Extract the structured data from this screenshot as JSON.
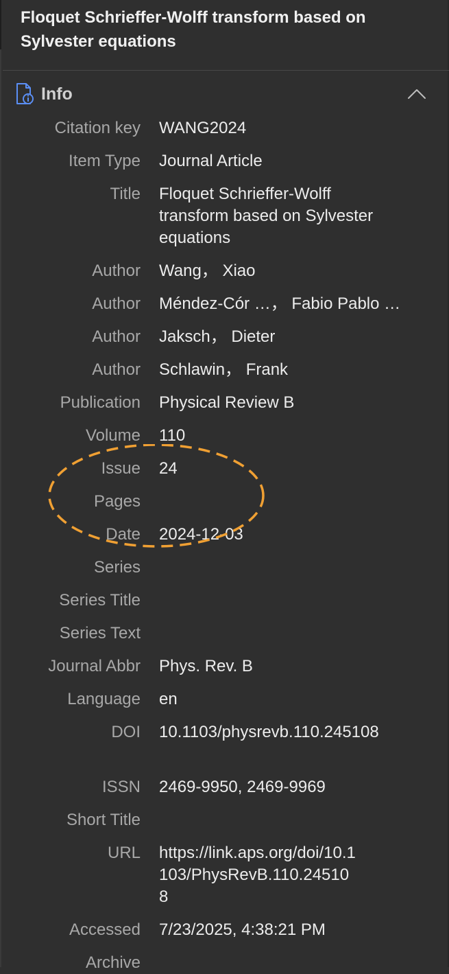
{
  "header": {
    "title": "Floquet Schrieffer-Wolff transform based on Sylvester equations"
  },
  "section": {
    "label": "Info",
    "icon": "document-info-icon",
    "collapse_icon": "chevron-up-icon"
  },
  "fields": {
    "citation_key": {
      "label": "Citation key",
      "value": "WANG2024"
    },
    "item_type": {
      "label": "Item Type",
      "value": "Journal Article"
    },
    "title": {
      "label": "Title",
      "value": "Floquet Schrieffer-Wolff transform based on Sylvester equations"
    },
    "author1": {
      "label": "Author",
      "value": "Wang， Xiao"
    },
    "author2": {
      "label": "Author",
      "value": "Méndez-Cór …， Fabio Pablo …"
    },
    "author3": {
      "label": "Author",
      "value": "Jaksch， Dieter"
    },
    "author4": {
      "label": "Author",
      "value": "Schlawin， Frank"
    },
    "publication": {
      "label": "Publication",
      "value": "Physical Review B"
    },
    "volume": {
      "label": "Volume",
      "value": "110"
    },
    "issue": {
      "label": "Issue",
      "value": "24"
    },
    "pages": {
      "label": "Pages",
      "value": ""
    },
    "date": {
      "label": "Date",
      "value": "2024-12-03"
    },
    "series": {
      "label": "Series",
      "value": ""
    },
    "series_title": {
      "label": "Series Title",
      "value": ""
    },
    "series_text": {
      "label": "Series Text",
      "value": ""
    },
    "journal_abbr": {
      "label": "Journal Abbr",
      "value": "Phys. Rev. B"
    },
    "language": {
      "label": "Language",
      "value": "en"
    },
    "doi": {
      "label": "DOI",
      "value": "10.1103/physrevb.110.245108"
    },
    "issn": {
      "label": "ISSN",
      "value": "2469-9950, 2469-9969"
    },
    "short_title": {
      "label": "Short Title",
      "value": ""
    },
    "url": {
      "label": "URL",
      "value": "https://link.aps.org/doi/10.1103/PhysRevB.110.245108"
    },
    "accessed": {
      "label": "Accessed",
      "value": "7/23/2025, 4:38:21 PM"
    },
    "archive": {
      "label": "Archive",
      "value": ""
    }
  },
  "colors": {
    "background": "#2f2f2f",
    "label": "#a8a8a8",
    "value": "#ececec",
    "annotation": "#f0a033"
  }
}
